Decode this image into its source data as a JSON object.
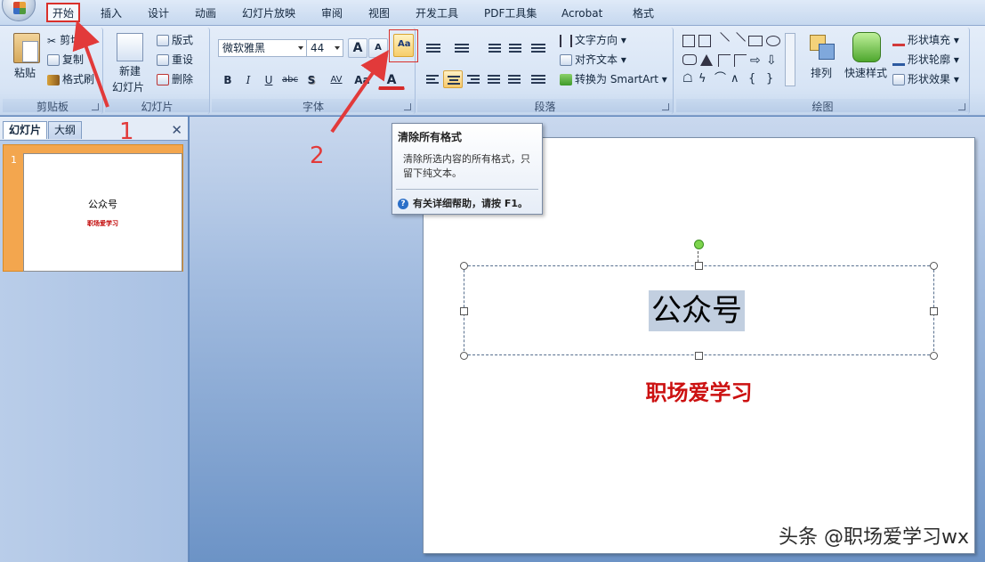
{
  "tabs": [
    "开始",
    "插入",
    "设计",
    "动画",
    "幻灯片放映",
    "审阅",
    "视图",
    "开发工具",
    "PDF工具集",
    "Acrobat",
    "格式"
  ],
  "active_tab": "开始",
  "clipboard": {
    "paste": "粘贴",
    "cut": "剪切",
    "copy": "复制",
    "format_painter": "格式刷",
    "group_label": "剪贴板"
  },
  "slides_group": {
    "new_slide_line1": "新建",
    "new_slide_line2": "幻灯片",
    "layout": "版式",
    "reset": "重设",
    "delete": "删除",
    "group_label": "幻灯片"
  },
  "font_group": {
    "font_name": "微软雅黑",
    "font_size": "44",
    "bold": "B",
    "italic": "I",
    "underline": "U",
    "strikethrough": "abc",
    "shadow": "S",
    "spacing": "AV",
    "grow": "A",
    "shrink": "A",
    "case": "Aa",
    "color": "A",
    "group_label": "字体",
    "accent_red": "#d9302b"
  },
  "paragraph_group": {
    "text_direction": "文字方向",
    "align_text": "对齐文本",
    "convert_smartart": "转换为 SmartArt",
    "group_label": "段落"
  },
  "drawing_group": {
    "arrange": "排列",
    "quick_styles": "快速样式",
    "shape_fill": "形状填充",
    "shape_outline": "形状轮廓",
    "shape_effects": "形状效果",
    "group_label": "绘图"
  },
  "tooltip": {
    "title": "清除所有格式",
    "body": "清除所选内容的所有格式，只留下纯文本。",
    "help": "有关详细帮助，请按 F1。"
  },
  "left_panel": {
    "tab_slides": "幻灯片",
    "tab_outline": "大纲",
    "close": "✕",
    "thumb_number": "1",
    "thumb_title": "公众号",
    "thumb_subtitle": "职场爱学习"
  },
  "slide": {
    "title": "公众号",
    "subtitle": "职场爱学习",
    "subtitle_color": "#cc1111"
  },
  "annotations": {
    "label1": "1",
    "label2": "2"
  },
  "watermark": "头条 @职场爱学习wx"
}
